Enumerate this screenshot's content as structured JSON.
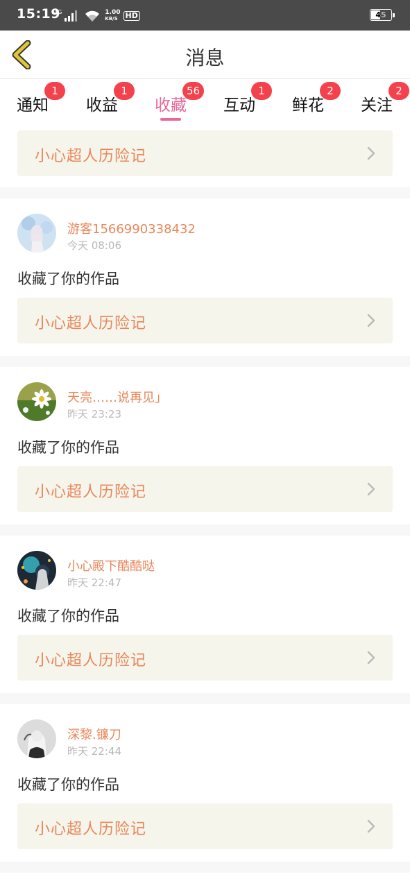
{
  "status_bar": {
    "time": "15:19",
    "network_tag": "4G",
    "speed_value": "1.00",
    "speed_unit": "KB/S",
    "hd": "HD",
    "battery": "45"
  },
  "header": {
    "title": "消息",
    "back_icon": "chevron-left-icon"
  },
  "tabs": [
    {
      "label": "通知",
      "badge": "1"
    },
    {
      "label": "收益",
      "badge": "1"
    },
    {
      "label": "收藏",
      "badge": "56",
      "active": true
    },
    {
      "label": "互动",
      "badge": "1"
    },
    {
      "label": "鲜花",
      "badge": "2"
    },
    {
      "label": "关注",
      "badge": "2"
    }
  ],
  "feed": {
    "top_card": {
      "work_title": "小心超人历险记"
    },
    "entries": [
      {
        "user": "游客1566990338432",
        "time": "今天 08:06",
        "action": "收藏了你的作品",
        "work_title": "小心超人历险记"
      },
      {
        "user": "天亮……说再见」",
        "time": "昨天 23:23",
        "action": "收藏了你的作品",
        "work_title": "小心超人历险记"
      },
      {
        "user": "小心殿下酷酷哒",
        "time": "昨天 22:47",
        "action": "收藏了你的作品",
        "work_title": "小心超人历险记"
      },
      {
        "user": "深黎.镰刀",
        "time": "昨天 22:44",
        "action": "收藏了你的作品",
        "work_title": "小心超人历险记"
      }
    ]
  },
  "colors": {
    "accent_pink": "#e8669a",
    "badge_red": "#f4424c",
    "name_orange": "#e8875a",
    "card_bg": "#f5f5ec",
    "back_arrow": "#e0c534"
  }
}
